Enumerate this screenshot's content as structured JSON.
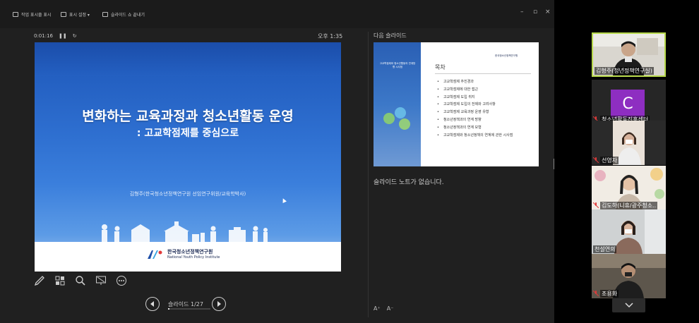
{
  "toolbar": {
    "show_taskbar": "작업 표시줄 표시",
    "display_settings": "표시 설정 ▾",
    "end_slideshow": "슬라이드 쇼 끝내기"
  },
  "presenter": {
    "elapsed": "0:01:16",
    "clock": "오후 1:35",
    "slide_counter": "슬라이드 1/27",
    "progress_fraction": 0.04
  },
  "current_slide": {
    "title": "변화하는 교육과정과 청소년활동 운영",
    "subtitle": ": 고교학점제를 중심으로",
    "author": "김형주(한국청소년정책연구원 선임연구위원/교육학박사)",
    "org_name": "한국청소년정책연구원",
    "org_name_en": "National Youth Policy Institute"
  },
  "next_slide": {
    "label": "다음 슬라이드",
    "side_text": "고교학점제와 청소년활동의 연계방향 시사점",
    "logo_text": "한국청소년정책연구원",
    "toc_title": "목차",
    "toc_items": [
      "고교학점제 추진경과",
      "고교학점제에 대한 접근",
      "고교학점제 도입 취지",
      "고교학점제 도입의 전제와 고려사항",
      "고교학점제 교육과정 운영 유형",
      "청소년정책과의 연계 방향",
      "청소년정책과의 연계 모형",
      "고교학점제와 청소년정책의 연계에 관한 시사점"
    ]
  },
  "notes": {
    "text": "슬라이드 노트가 없습니다."
  },
  "font_controls": {
    "increase": "A⁺",
    "decrease": "A⁻"
  },
  "participants": [
    {
      "name": "김형주(청년정책연구실)",
      "active": true,
      "muted": false
    },
    {
      "name": "청소년활동진흥센터",
      "avatar_letter": "C",
      "muted": true
    },
    {
      "name": "선영자",
      "muted": true
    },
    {
      "name": "김도하(니휴/광주청소..",
      "muted": true
    },
    {
      "name": "천설연의",
      "muted": false
    },
    {
      "name": "조용화",
      "muted": true
    }
  ],
  "colors": {
    "active_border": "#b7d84b",
    "avatar_bg": "#8e2ec1",
    "mic_off": "#e03a3a",
    "slide_blue": "#2e6fd0"
  }
}
